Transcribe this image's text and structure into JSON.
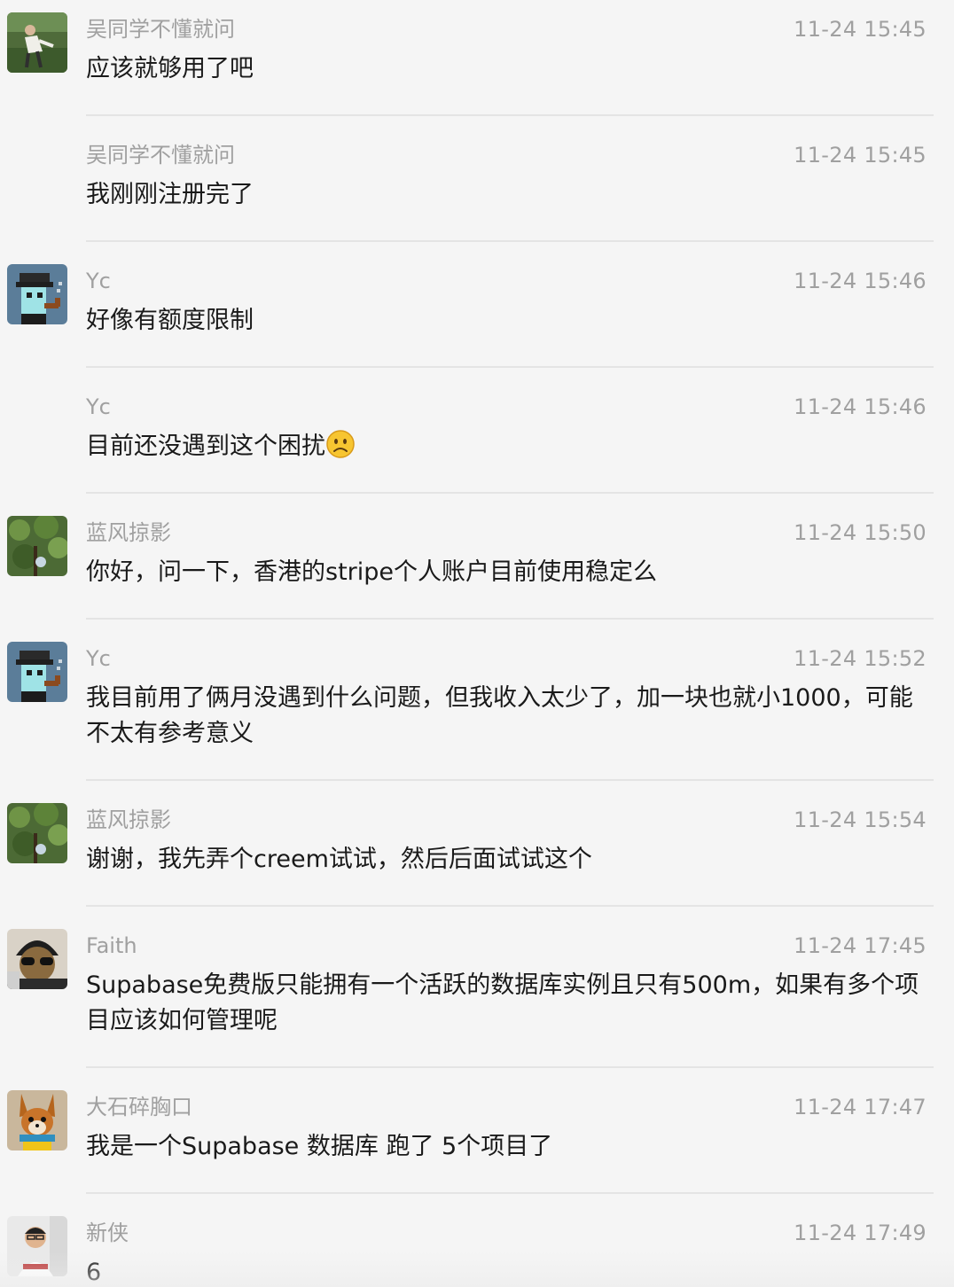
{
  "messages": [
    {
      "sender": "吴同学不懂就问",
      "time": "11-24 15:45",
      "text": "应该就够用了吧",
      "avatar": "avatar-photo-outdoor-person"
    },
    {
      "sender": "吴同学不懂就问",
      "time": "11-24 15:45",
      "text": "我刚刚注册完了",
      "avatar": ""
    },
    {
      "sender": "Yc",
      "time": "11-24 15:46",
      "text": "好像有额度限制",
      "avatar": "avatar-pixel-pipe-character"
    },
    {
      "sender": "Yc",
      "time": "11-24 15:46",
      "text": "目前还没遇到这个困扰",
      "emoji": "frowning-face-emoji",
      "avatar": ""
    },
    {
      "sender": "蓝风掠影",
      "time": "11-24 15:50",
      "text": "你好，问一下，香港的stripe个人账户目前使用稳定么",
      "avatar": "avatar-photo-tree-leaves"
    },
    {
      "sender": "Yc",
      "time": "11-24 15:52",
      "text": "我目前用了俩月没遇到什么问题，但我收入太少了，加一块也就小1000，可能不太有参考意义",
      "avatar": "avatar-pixel-pipe-character"
    },
    {
      "sender": "蓝风掠影",
      "time": "11-24 15:54",
      "text": "谢谢，我先弄个creem试试，然后后面试试这个",
      "avatar": "avatar-photo-tree-leaves"
    },
    {
      "sender": "Faith",
      "time": "11-24 17:45",
      "text": "Supabase免费版只能拥有一个活跃的数据库实例且只有500m，如果有多个项目应该如何管理呢",
      "avatar": "avatar-photo-sunglasses-beanie"
    },
    {
      "sender": "大石碎胸口",
      "time": "11-24 17:47",
      "text": "我是一个Supabase 数据库 跑了 5个项目了",
      "avatar": "avatar-cartoon-fox"
    },
    {
      "sender": "新侠",
      "time": "11-24 17:49",
      "text": "6",
      "avatar": "avatar-photo-man-glasses"
    }
  ],
  "colors": {
    "background": "#f5f5f5",
    "meta_text": "#a0a0a0",
    "body_text": "#1a1a1a",
    "divider": "#e4e4e4"
  }
}
